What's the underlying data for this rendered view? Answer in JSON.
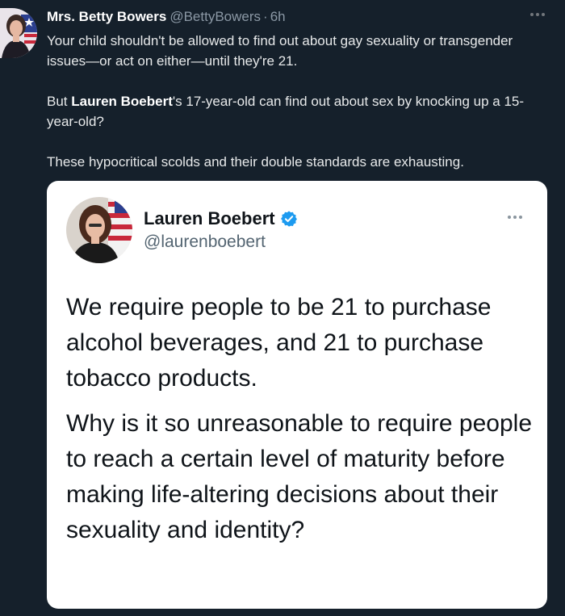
{
  "tweet": {
    "author_name": "Mrs. Betty Bowers",
    "author_handle": "@BettyBowers",
    "separator": "·",
    "timestamp": "6h",
    "more_label": "···",
    "paragraphs": [
      {
        "text": "Your child shouldn't be allowed to find out about gay sexuality or transgender issues—or act on either—until they're 21."
      },
      {
        "pre": "But ",
        "mention": "Lauren Boebert",
        "post": "'s 17-year-old can find out about sex by knocking up a 15-year-old?"
      },
      {
        "text": "These hypocritical scolds and their double standards are exhausting."
      }
    ]
  },
  "embedded": {
    "author_name": "Lauren Boebert",
    "author_handle": "@laurenboebert",
    "more_label": "···",
    "verified_color": "#1d9bf0",
    "paragraphs": [
      "We require people to be 21 to purchase alcohol beverages, and 21 to purchase tobacco products.",
      "Why is it so unreasonable to require people to reach a certain level of maturity before making life-altering decisions about their sexuality and identity?"
    ]
  },
  "icons": {
    "outer_more": "more-horizontal-icon",
    "inner_more": "more-horizontal-icon",
    "verified": "verified-badge-icon"
  }
}
